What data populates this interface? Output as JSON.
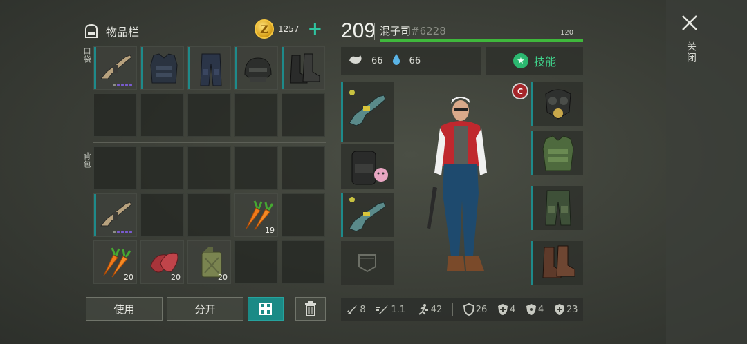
{
  "inventory": {
    "title": "物品栏",
    "coins": "1257",
    "pocket_label": "口袋",
    "backpack_label": "背包",
    "counts": {
      "carrots_a": "19",
      "carrots_b": "20",
      "meat": "20",
      "fuel": "20"
    }
  },
  "buttons": {
    "use": "使用",
    "split": "分开"
  },
  "player": {
    "level": "209",
    "name": "混子司",
    "tag": "#6228",
    "xp_max": "120",
    "xp_fraction": 1.0,
    "food": "66",
    "water": "66"
  },
  "skills_label": "技能",
  "close_label": "关闭",
  "badge_letter": "C",
  "stats": {
    "damage": "8",
    "attack_speed": "1.1",
    "move_speed": "42",
    "armor": "26",
    "cold": "4",
    "radiation": "4",
    "bio": "23"
  },
  "colors": {
    "accent_teal": "#1b8a86",
    "xp_green": "#3fb83c",
    "skill_green": "#3fd18a",
    "coin_gold": "#f5c742",
    "rarity_purple": "#7a5bd0"
  }
}
